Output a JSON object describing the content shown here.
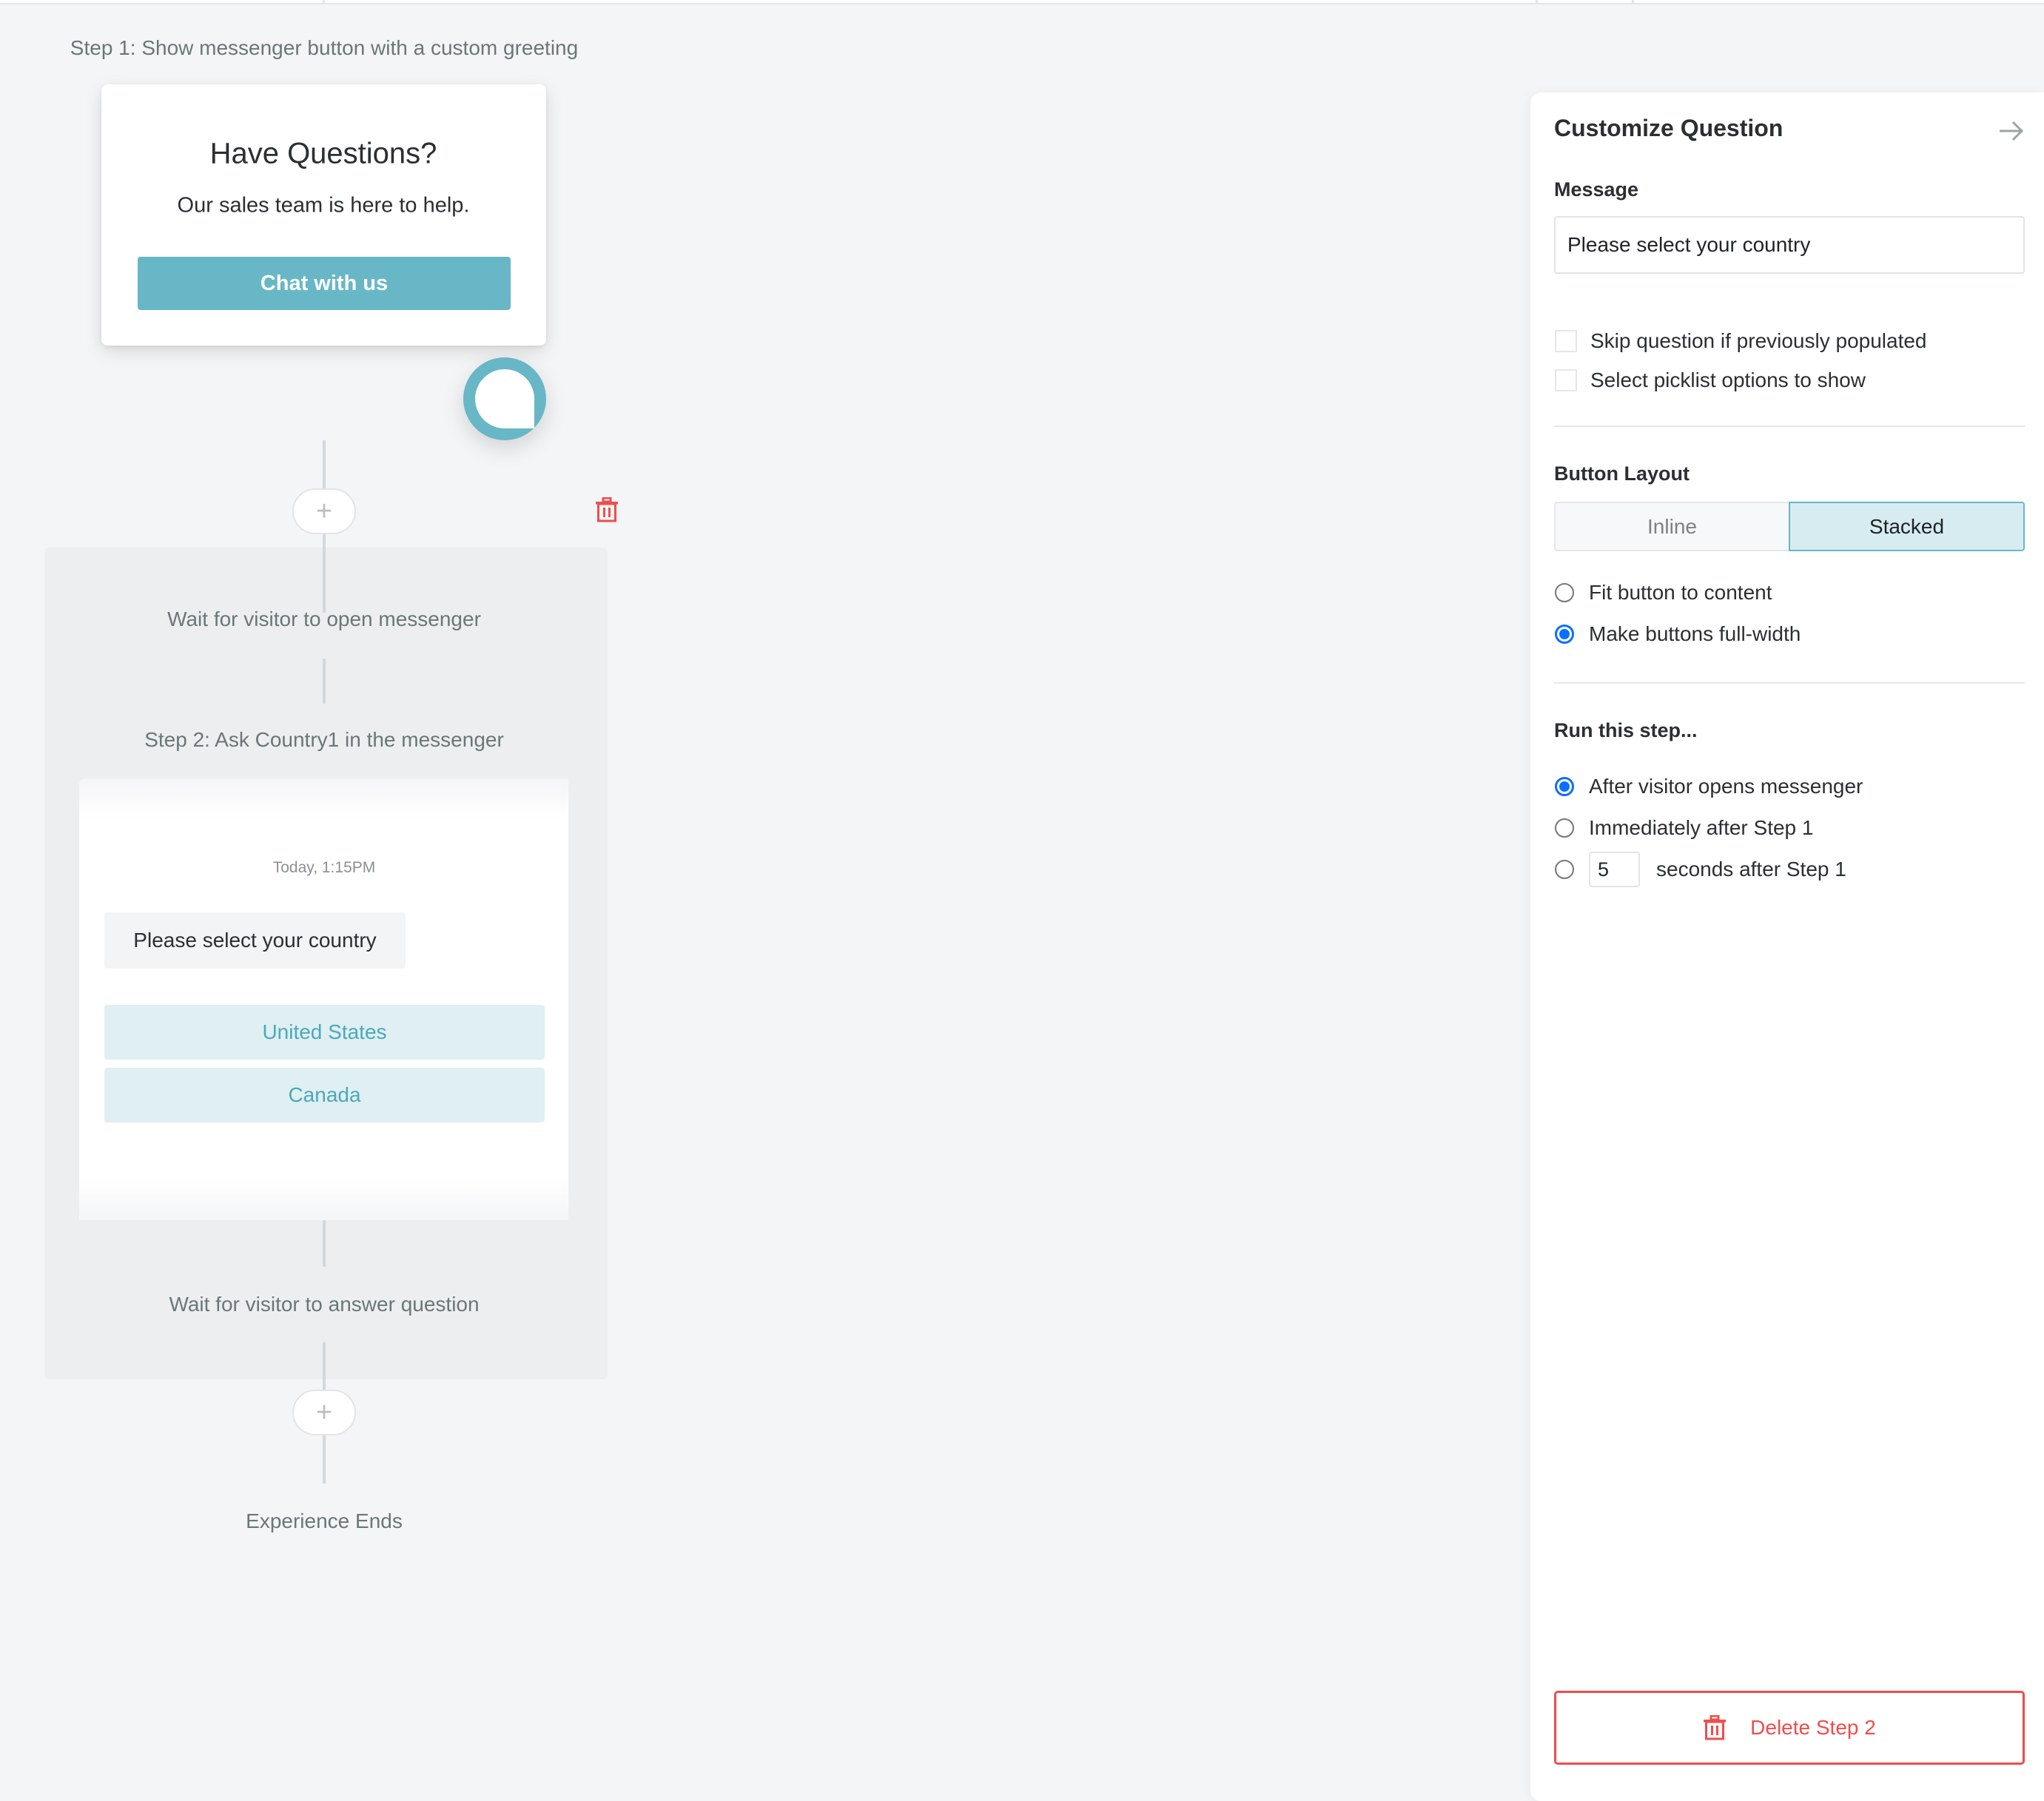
{
  "canvas": {
    "step1": {
      "label": "Step 1: Show messenger button with a custom greeting",
      "greeting": {
        "title": "Have Questions?",
        "subtitle": "Our sales team is here to help.",
        "button_label": "Chat with us"
      },
      "launcher_icon": "chat-bubble-icon"
    },
    "add_step_icon": "plus-icon",
    "delete_icon": "trash-icon",
    "group": {
      "wait_label": "Wait for visitor to open messenger",
      "step2_label": "Step 2: Ask Country1 in the messenger",
      "preview": {
        "timestamp": "Today, 1:15PM",
        "message": "Please select your country",
        "options": [
          "United States",
          "Canada"
        ]
      },
      "wait_answer_label": "Wait for visitor to answer question"
    },
    "end_label": "Experience Ends"
  },
  "panel": {
    "title": "Customize Question",
    "close_icon": "arrow-right-icon",
    "message_label": "Message",
    "message_value": "Please select your country",
    "checkboxes": [
      {
        "label": "Skip question if previously populated",
        "checked": false
      },
      {
        "label": "Select picklist options to show",
        "checked": false
      }
    ],
    "button_layout": {
      "label": "Button Layout",
      "options": [
        "Inline",
        "Stacked"
      ],
      "selected": "Stacked",
      "width_options": [
        {
          "label": "Fit button to content",
          "checked": false
        },
        {
          "label": "Make buttons full-width",
          "checked": true
        }
      ]
    },
    "run_step": {
      "label": "Run this step...",
      "options": [
        {
          "label": "After visitor opens messenger",
          "checked": true
        },
        {
          "label": "Immediately after Step 1",
          "checked": false
        },
        {
          "label": "seconds after Step 1",
          "checked": false,
          "delay_value": "5"
        }
      ]
    },
    "delete_button_label": "Delete Step 2"
  },
  "colors": {
    "accent_teal": "#68b7c6",
    "danger_red": "#f04d4d",
    "radio_blue": "#0d6efd"
  }
}
